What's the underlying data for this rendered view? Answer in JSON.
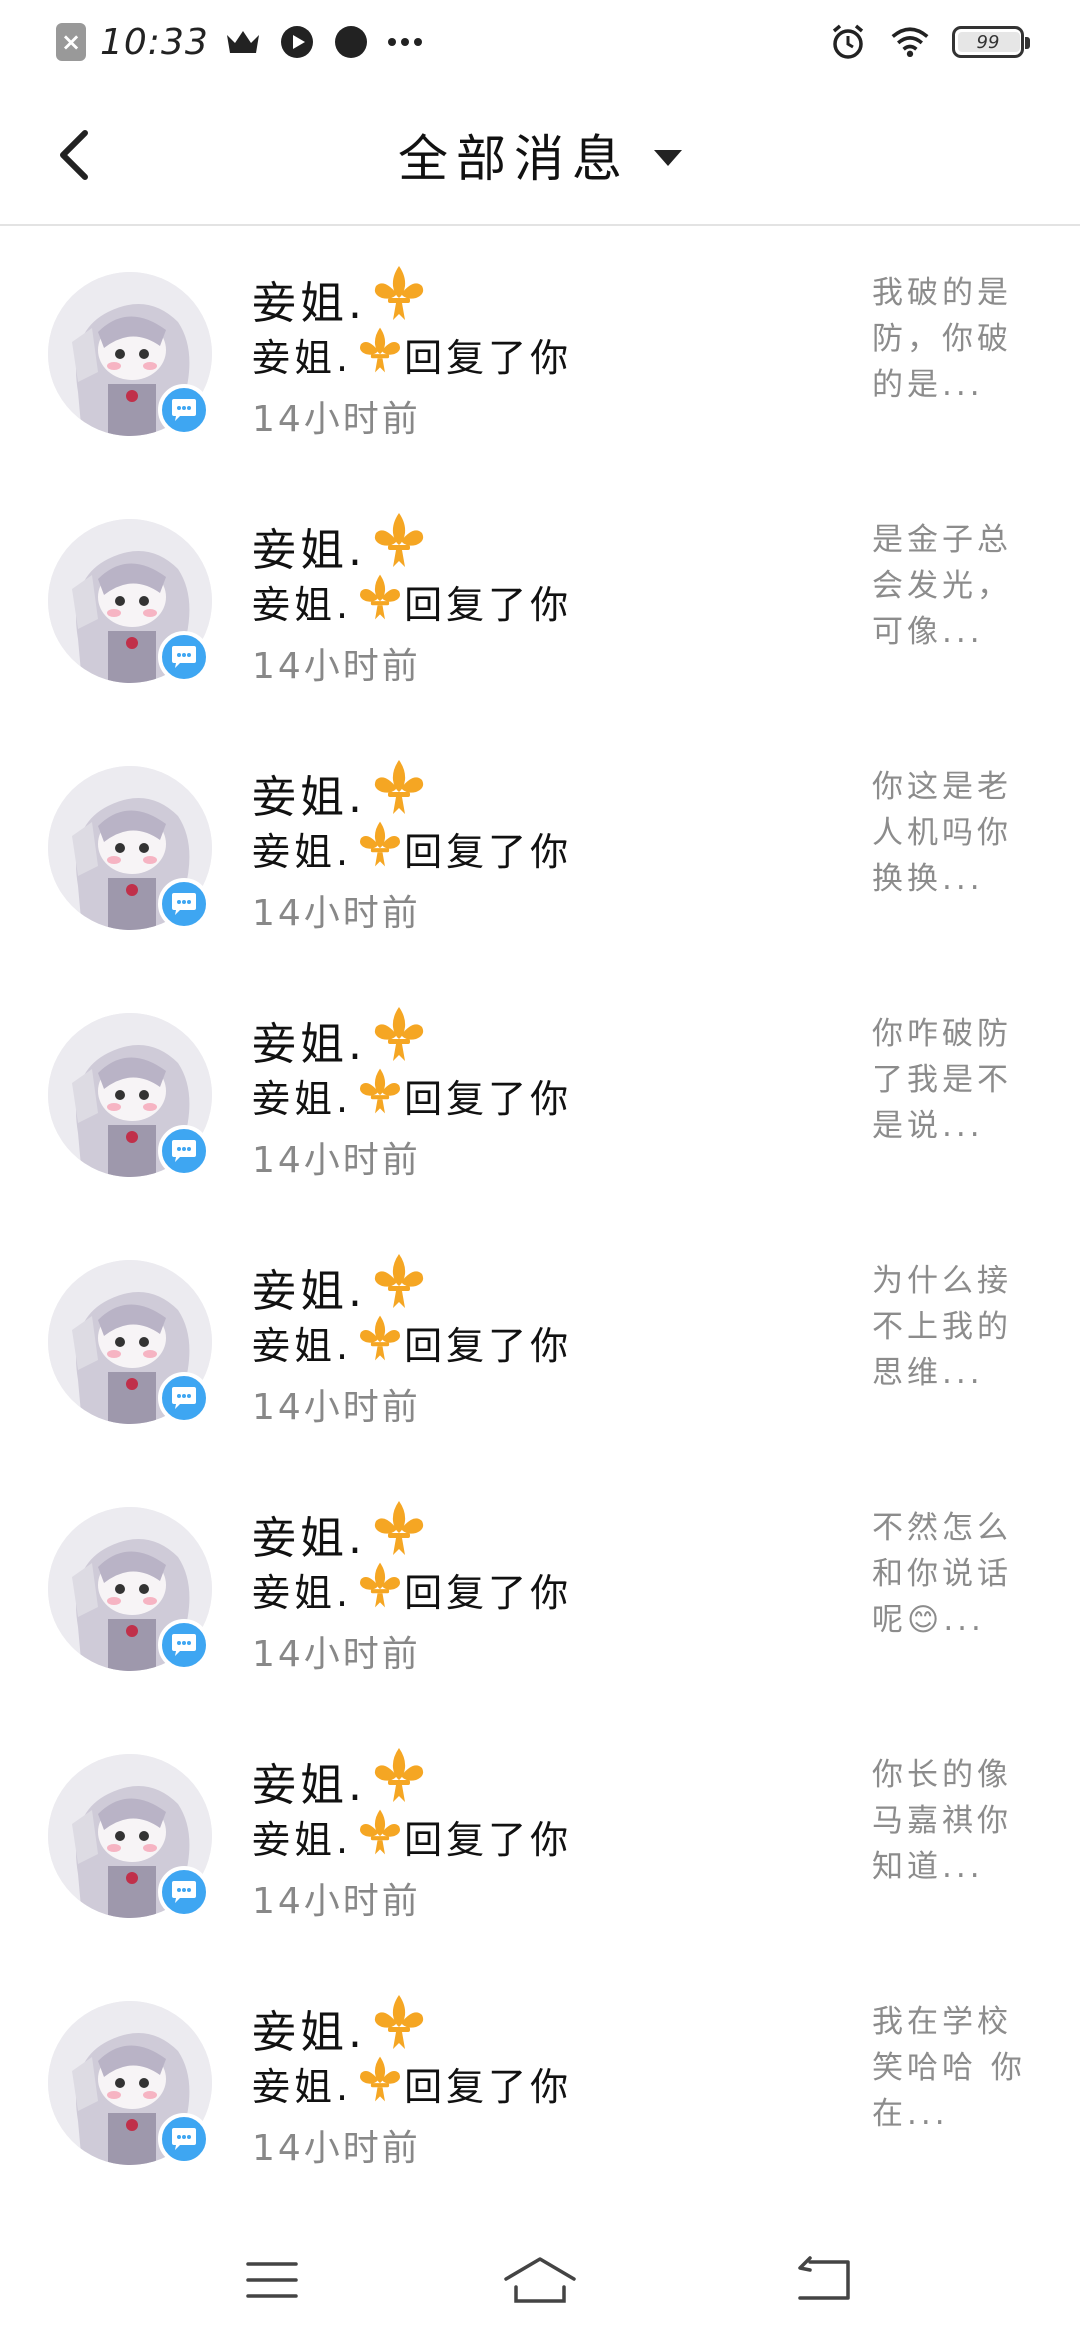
{
  "status_bar": {
    "time": "10:33",
    "battery": "99"
  },
  "header": {
    "title": "全部消息"
  },
  "messages": [
    {
      "name": "妾姐.",
      "action_name": "妾姐.",
      "action": "回复了你",
      "time": "14小时前",
      "preview": "我破的是防，你破的是..."
    },
    {
      "name": "妾姐.",
      "action_name": "妾姐.",
      "action": "回复了你",
      "time": "14小时前",
      "preview": "是金子总会发光，可像..."
    },
    {
      "name": "妾姐.",
      "action_name": "妾姐.",
      "action": "回复了你",
      "time": "14小时前",
      "preview": "你这是老人机吗你换换..."
    },
    {
      "name": "妾姐.",
      "action_name": "妾姐.",
      "action": "回复了你",
      "time": "14小时前",
      "preview": "你咋破防了我是不是说..."
    },
    {
      "name": "妾姐.",
      "action_name": "妾姐.",
      "action": "回复了你",
      "time": "14小时前",
      "preview": "为什么接不上我的思维..."
    },
    {
      "name": "妾姐.",
      "action_name": "妾姐.",
      "action": "回复了你",
      "time": "14小时前",
      "preview": "不然怎么和你说话呢😊..."
    },
    {
      "name": "妾姐.",
      "action_name": "妾姐.",
      "action": "回复了你",
      "time": "14小时前",
      "preview": "你长的像马嘉祺你知道..."
    },
    {
      "name": "妾姐.",
      "action_name": "妾姐.",
      "action": "回复了你",
      "time": "14小时前",
      "preview": "我在学校笑哈哈 你在..."
    }
  ],
  "icons": {
    "back": "back-chevron-icon",
    "dropdown": "caret-down-icon",
    "badge": "chat-bubble-icon",
    "name_decoration": "fleur-de-lis-icon",
    "nav_menu": "menu-icon",
    "nav_home": "home-icon",
    "nav_back": "return-icon"
  },
  "colors": {
    "badge": "#3ea6f2",
    "fleur": "#f5a623",
    "preview_text": "#8c8c8c"
  }
}
